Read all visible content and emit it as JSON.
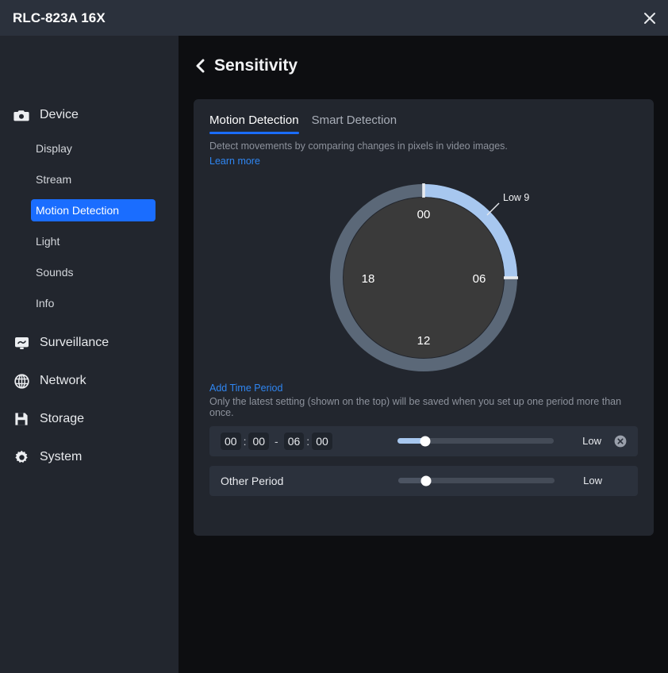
{
  "titlebar": {
    "device_name": "RLC-823A 16X",
    "close_icon": "close-icon"
  },
  "sidebar": {
    "groups": [
      {
        "icon": "camera-icon",
        "label": "Device",
        "items": [
          {
            "label": "Display",
            "active": false
          },
          {
            "label": "Stream",
            "active": false
          },
          {
            "label": "Motion Detection",
            "active": true
          },
          {
            "label": "Light",
            "active": false
          },
          {
            "label": "Sounds",
            "active": false
          },
          {
            "label": "Info",
            "active": false
          }
        ]
      },
      {
        "icon": "monitor-icon",
        "label": "Surveillance",
        "items": []
      },
      {
        "icon": "globe-icon",
        "label": "Network",
        "items": []
      },
      {
        "icon": "floppy-disk-icon",
        "label": "Storage",
        "items": []
      },
      {
        "icon": "gear-icon",
        "label": "System",
        "items": []
      }
    ]
  },
  "page": {
    "back_icon": "chevron-left-icon",
    "title": "Sensitivity"
  },
  "tabs": [
    {
      "label": "Motion Detection",
      "active": true
    },
    {
      "label": "Smart Detection",
      "active": false
    }
  ],
  "description": {
    "text": "Detect movements by comparing changes in pixels in video images.",
    "learn_more": "Learn more"
  },
  "dial": {
    "hour_labels": [
      "00",
      "06",
      "12",
      "18"
    ],
    "callout": "Low 9",
    "arc_start_hour": 0,
    "arc_end_hour": 6,
    "ring_color": "#5b6878",
    "arc_color": "#a7c7ef",
    "inner_color": "#3a3a3a",
    "marker_color": "#e8eaee"
  },
  "add_period": {
    "link": "Add Time Period",
    "note": "Only the latest setting (shown on the top) will be saved when you set up one period more than once."
  },
  "periods": [
    {
      "type": "time",
      "start_hour": "00",
      "start_minute": "00",
      "dash": "-",
      "end_hour": "06",
      "end_minute": "00",
      "colon": ":",
      "slider_percent": 18,
      "level": "Low",
      "active": true,
      "remove_icon": "close-circle-icon"
    },
    {
      "type": "other",
      "label": "Other Period",
      "slider_percent": 18,
      "level": "Low",
      "active": false
    }
  ],
  "colors": {
    "accent": "#1a6dff",
    "link": "#2f86f2",
    "titlebar_bg": "#2b313c",
    "sidebar_bg": "#22262e",
    "main_bg": "#0d0e11",
    "card_bg": "#22262e",
    "row_bg": "#2b313c"
  }
}
